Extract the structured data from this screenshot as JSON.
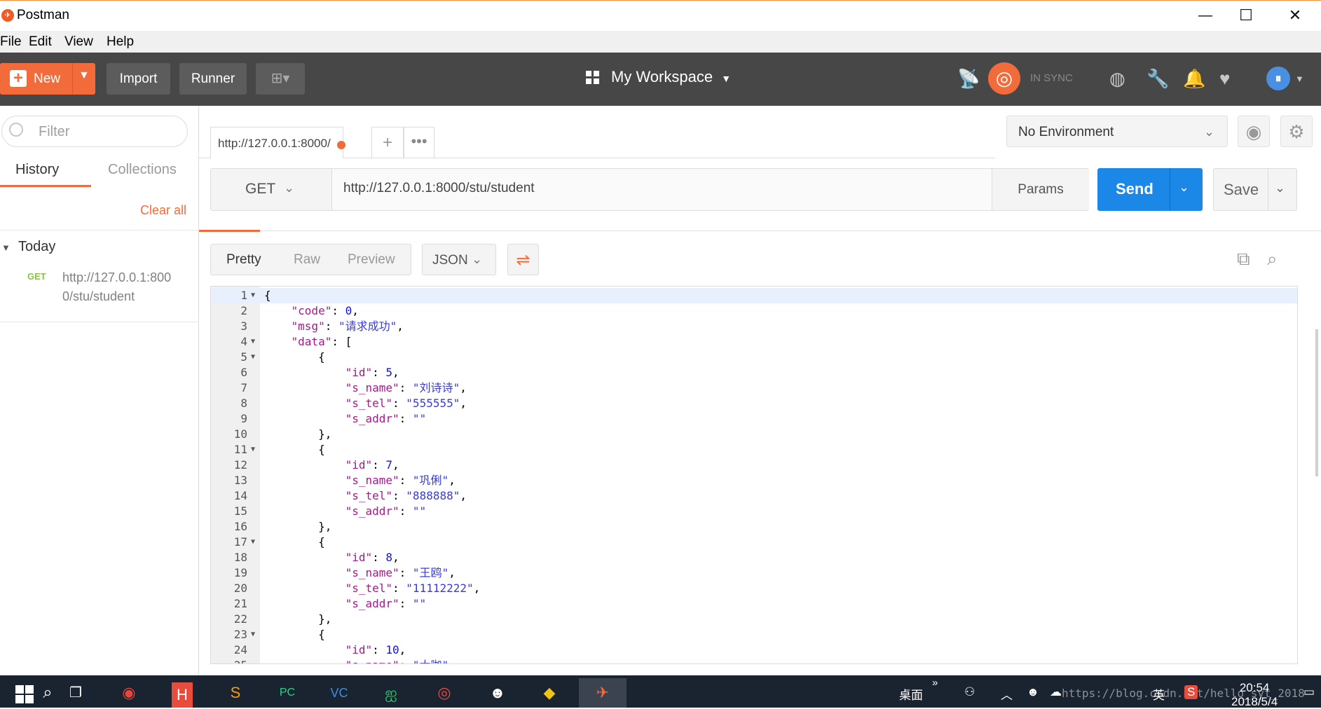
{
  "window": {
    "title": "Postman",
    "minimize": "—",
    "maximize": "☐",
    "close": "✕"
  },
  "menu": [
    "File",
    "Edit",
    "View",
    "Help"
  ],
  "toolbar": {
    "new_label": "New",
    "import_label": "Import",
    "runner_label": "Runner",
    "workspace_label": "My Workspace",
    "sync_status": "IN SYNC",
    "accent": "#f26b3a"
  },
  "sidebar": {
    "filter_placeholder": "Filter",
    "tabs": [
      "History",
      "Collections"
    ],
    "clear_all": "Clear all",
    "group": "Today",
    "history": [
      {
        "method": "GET",
        "url": "http://127.0.0.1:8000/stu/student"
      }
    ]
  },
  "request": {
    "tab_title": "http://127.0.0.1:8000/",
    "method": "GET",
    "url": "http://127.0.0.1:8000/stu/student",
    "params_label": "Params",
    "send_label": "Send",
    "save_label": "Save"
  },
  "environment": {
    "selected": "No Environment"
  },
  "response": {
    "view_options": [
      "Pretty",
      "Raw",
      "Preview"
    ],
    "format": "JSON",
    "code_lines": [
      "{",
      "    \"code\": 0,",
      "    \"msg\": \"请求成功\",",
      "    \"data\": [",
      "        {",
      "            \"id\": 5,",
      "            \"s_name\": \"刘诗诗\",",
      "            \"s_tel\": \"555555\",",
      "            \"s_addr\": \"\"",
      "        },",
      "        {",
      "            \"id\": 7,",
      "            \"s_name\": \"巩俐\",",
      "            \"s_tel\": \"888888\",",
      "            \"s_addr\": \"\"",
      "        },",
      "        {",
      "            \"id\": 8,",
      "            \"s_name\": \"王鸥\",",
      "            \"s_tel\": \"11112222\",",
      "            \"s_addr\": \"\"",
      "        },",
      "        {",
      "            \"id\": 10,",
      "            \"s_name\": \"大咖\","
    ],
    "foldable_lines": [
      1,
      4,
      5,
      11,
      17,
      23
    ]
  },
  "taskbar": {
    "desktop_label": "桌面",
    "ime": "英",
    "time": "20:54",
    "date": "2018/5/4",
    "watermark": "https://blog.csdn.net/hello_syt_2018"
  }
}
